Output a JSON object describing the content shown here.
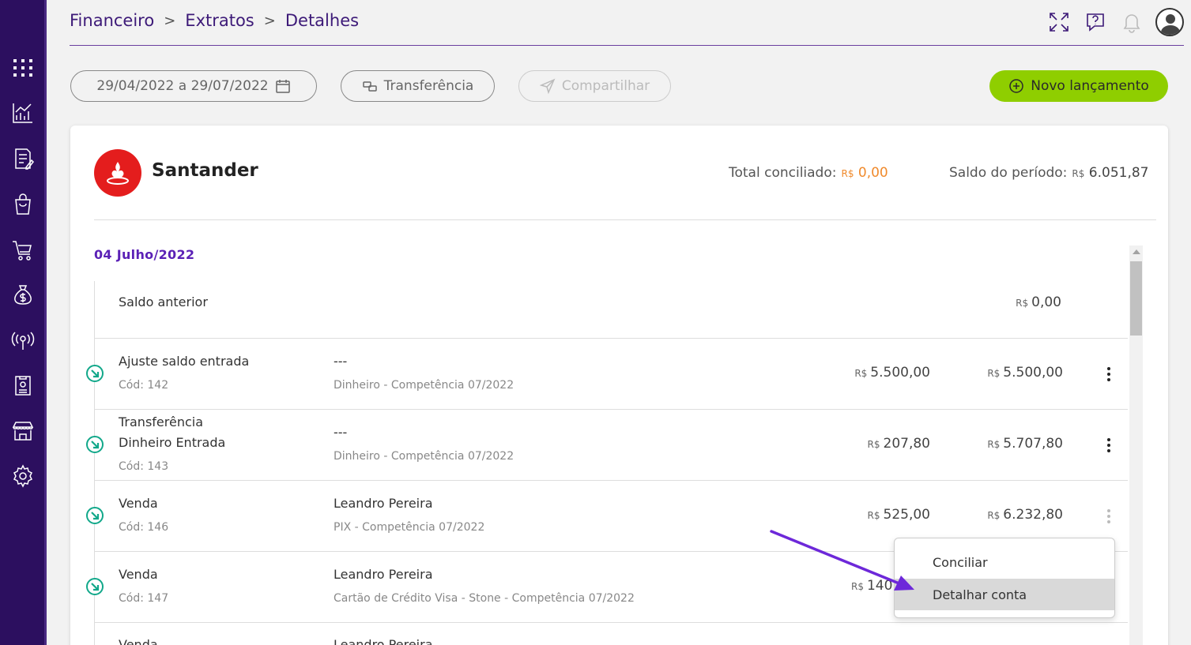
{
  "breadcrumb": {
    "items": [
      "Financeiro",
      "Extratos",
      "Detalhes"
    ],
    "separator": ">"
  },
  "toolbar": {
    "date_range": "29/04/2022 a 29/07/2022",
    "transfer_label": "Transferência",
    "share_label": "Compartilhar",
    "new_entry_label": "Novo lançamento"
  },
  "account": {
    "bank_name": "Santander",
    "total_reconciled_label": "Total conciliado:",
    "total_reconciled_currency": "R$",
    "total_reconciled_value": "0,00",
    "period_balance_label": "Saldo do período:",
    "period_balance_currency": "R$",
    "period_balance_value": "6.051,87"
  },
  "statement": {
    "date_header": "04 Julho/2022",
    "previous_balance": {
      "label": "Saldo anterior",
      "currency": "R$",
      "value": "0,00"
    },
    "rows": [
      {
        "title": "Ajuste saldo entrada",
        "code": "Cód: 142",
        "party": "---",
        "detail": "Dinheiro - Competência 07/2022",
        "currency": "R$",
        "amount": "5.500,00",
        "balance_currency": "R$",
        "balance": "5.500,00"
      },
      {
        "title": "Transferência",
        "title2": "Dinheiro Entrada",
        "code": "Cód: 143",
        "party": "---",
        "detail": "Dinheiro - Competência 07/2022",
        "currency": "R$",
        "amount": "207,80",
        "balance_currency": "R$",
        "balance": "5.707,80"
      },
      {
        "title": "Venda",
        "code": "Cód: 146",
        "party": "Leandro Pereira",
        "detail": "PIX - Competência 07/2022",
        "currency": "R$",
        "amount": "525,00",
        "balance_currency": "R$",
        "balance": "6.232,80"
      },
      {
        "title": "Venda",
        "code": "Cód: 147",
        "party": "Leandro Pereira",
        "detail": "Cartão de Crédito Visa - Stone - Competência 07/2022",
        "currency": "R$",
        "amount": "140"
      },
      {
        "title": "Venda",
        "party": "Leandro Pereira"
      }
    ]
  },
  "context_menu": {
    "items": [
      "Conciliar",
      "Detalhar conta"
    ]
  },
  "colors": {
    "sidebar": "#2c0f5f",
    "brand_purple": "#3d1a78",
    "accent_green": "#8fce00",
    "income_teal": "#12a88a",
    "santander_red": "#e41d1d",
    "reconciled_orange": "#f08a2c",
    "annotation_arrow": "#6d28d9"
  },
  "icons": {
    "sidebar": [
      "apps-grid-icon",
      "chart-icon",
      "notes-icon",
      "shopping-bag-icon",
      "cart-icon",
      "money-bag-icon",
      "broadcast-icon",
      "document-icon",
      "storefront-icon",
      "gear-icon"
    ],
    "topbar": [
      "fullscreen-icon",
      "help-icon",
      "bell-icon",
      "user-avatar-icon"
    ]
  }
}
